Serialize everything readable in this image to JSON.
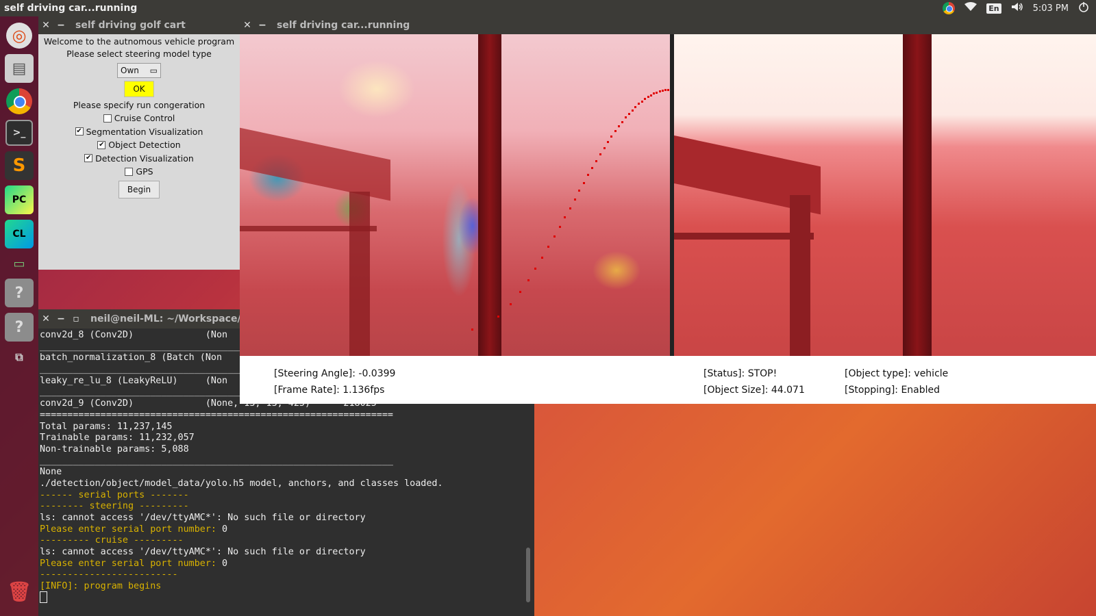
{
  "top_panel": {
    "title": "self driving car...running",
    "lang": "En",
    "time": "5:03 PM"
  },
  "launcher": {
    "items": [
      "ubuntu-icon",
      "files-icon",
      "chrome-icon",
      "terminal-icon",
      "sublime-icon",
      "pycharm-icon",
      "clion-icon",
      "system-monitor-icon",
      "help-icon",
      "help-icon",
      "workspace-icon",
      "trash-icon"
    ],
    "pycharm_label": "PC",
    "clion_label": "CL"
  },
  "cart_window": {
    "title": "self driving golf cart",
    "welcome": "Welcome to the autnomous vehicle program",
    "select_prompt": "Please select steering model type",
    "steering_model": "Own",
    "ok_label": "OK",
    "config_prompt": "Please specify run congeration",
    "options": [
      {
        "label": "Cruise Control",
        "checked": false
      },
      {
        "label": "Segmentation Visualization",
        "checked": true
      },
      {
        "label": "Object Detection",
        "checked": true
      },
      {
        "label": "Detection Visualization",
        "checked": true
      },
      {
        "label": "GPS",
        "checked": false
      }
    ],
    "begin_label": "Begin"
  },
  "terminal": {
    "title": "neil@neil-ML: ~/Workspace/s",
    "lines": [
      {
        "text": "conv2d_8 (Conv2D)             (Non",
        "yellow": false
      },
      {
        "text": "________________________________________________________________",
        "yellow": false
      },
      {
        "text": "batch_normalization_8 (Batch (Non",
        "yellow": false
      },
      {
        "text": "________________________________________________________________",
        "yellow": false
      },
      {
        "text": "leaky_re_lu_8 (LeakyReLU)     (Non",
        "yellow": false
      },
      {
        "text": "________________________________________________________________",
        "yellow": false
      },
      {
        "text": "conv2d_9 (Conv2D)             (None, 13, 13, 425)      218025",
        "yellow": false
      },
      {
        "text": "================================================================",
        "yellow": false
      },
      {
        "text": "Total params: 11,237,145",
        "yellow": false
      },
      {
        "text": "Trainable params: 11,232,057",
        "yellow": false
      },
      {
        "text": "Non-trainable params: 5,088",
        "yellow": false
      },
      {
        "text": "________________________________________________________________",
        "yellow": false
      },
      {
        "text": "None",
        "yellow": false
      },
      {
        "text": "./detection/object/model_data/yolo.h5 model, anchors, and classes loaded.",
        "yellow": false
      },
      {
        "text": "------ serial ports -------",
        "yellow": true
      },
      {
        "text": "-------- steering ---------",
        "yellow": true
      },
      {
        "text": "ls: cannot access '/dev/ttyAMC*': No such file or directory",
        "yellow": false
      },
      {
        "text": "Please enter serial port number: ",
        "yellow": true,
        "suffix": "0"
      },
      {
        "text": "--------- cruise ---------",
        "yellow": true
      },
      {
        "text": "ls: cannot access '/dev/ttyAMC*': No such file or directory",
        "yellow": false
      },
      {
        "text": "Please enter serial port number: ",
        "yellow": true,
        "suffix": "0"
      },
      {
        "text": "-------------------------",
        "yellow": true
      },
      {
        "text": "[INFO]: program begins",
        "yellow": true
      }
    ]
  },
  "video_window": {
    "title": "self driving car...running",
    "steering_angle": "[Steering Angle]: -0.0399",
    "frame_rate": "[Frame Rate]: 1.136fps",
    "status": "[Status]: STOP!",
    "object_size": "[Object Size]: 44.071",
    "object_type": "[Object type]: vehicle",
    "stopping": "[Stopping]: Enabled"
  },
  "colors": {
    "panel": "#3c3b37",
    "ok_button": "#ffff00",
    "terminal_bg": "#2f2f2f",
    "terminal_yellow": "#d9b200",
    "track_red": "#e00000"
  }
}
